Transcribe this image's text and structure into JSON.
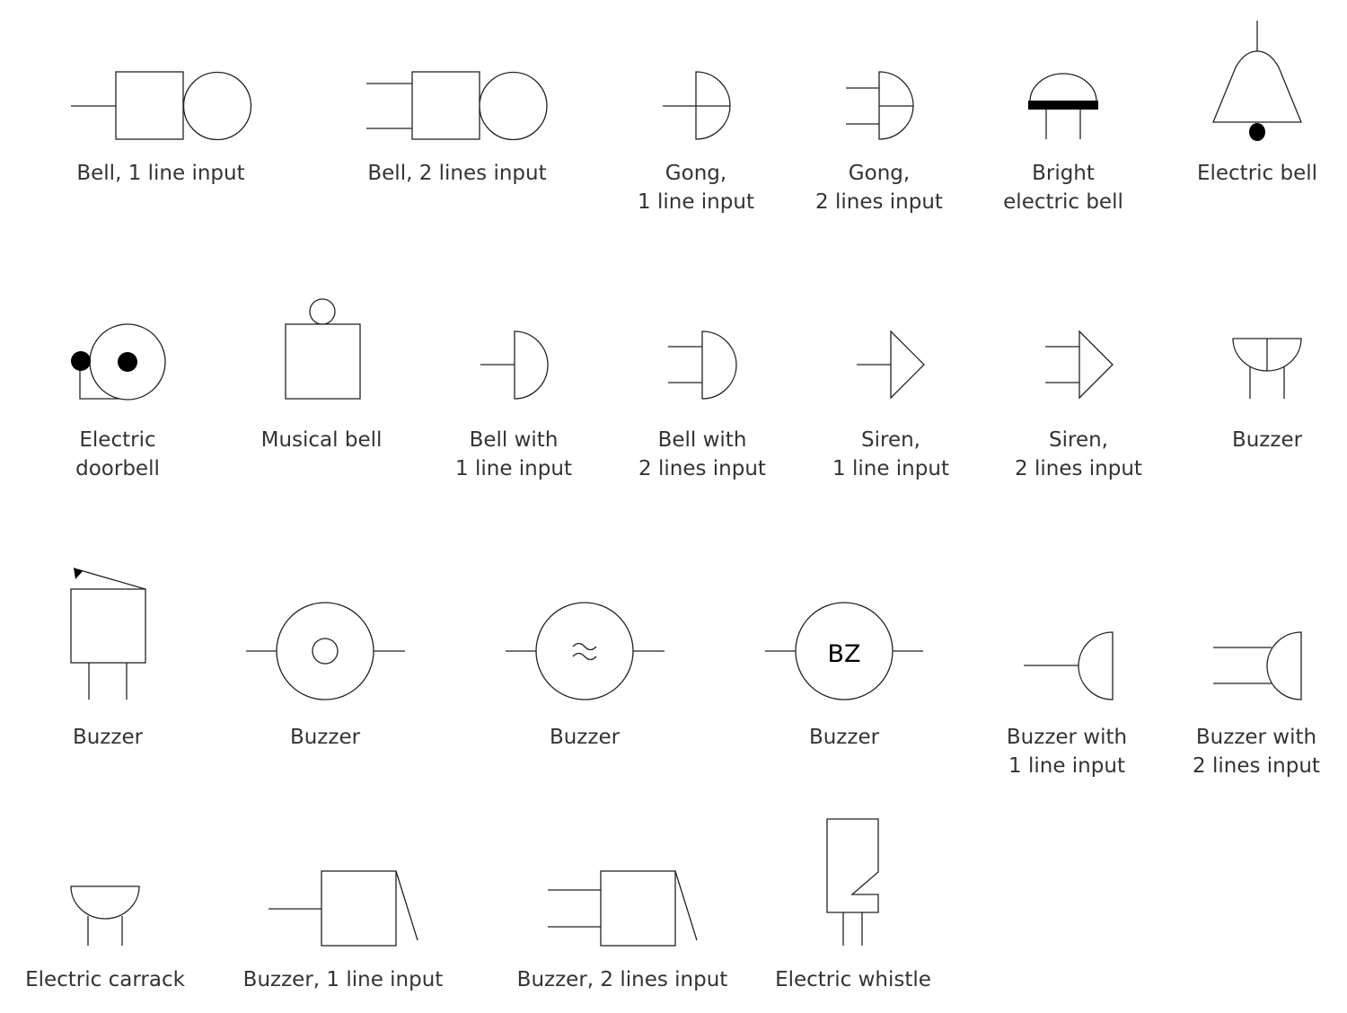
{
  "symbols": [
    {
      "id": "bell-1-line",
      "label": [
        "Bell, 1 line input"
      ]
    },
    {
      "id": "bell-2-lines",
      "label": [
        "Bell, 2 lines input"
      ]
    },
    {
      "id": "gong-1-line",
      "label": [
        "Gong,",
        "1 line input"
      ]
    },
    {
      "id": "gong-2-lines",
      "label": [
        "Gong,",
        "2 lines input"
      ]
    },
    {
      "id": "bright-electric-bell",
      "label": [
        "Bright",
        "electric bell"
      ]
    },
    {
      "id": "electric-bell",
      "label": [
        "Electric bell"
      ]
    },
    {
      "id": "electric-doorbell",
      "label": [
        "Electric",
        "doorbell"
      ]
    },
    {
      "id": "musical-bell",
      "label": [
        "Musical bell"
      ]
    },
    {
      "id": "bell-with-1-line",
      "label": [
        "Bell with",
        "1 line input"
      ]
    },
    {
      "id": "bell-with-2-lines",
      "label": [
        "Bell with",
        "2 lines input"
      ]
    },
    {
      "id": "siren-1-line",
      "label": [
        "Siren,",
        "1 line input"
      ]
    },
    {
      "id": "siren-2-lines",
      "label": [
        "Siren,",
        "2 lines input"
      ]
    },
    {
      "id": "buzzer-dome",
      "label": [
        "Buzzer"
      ]
    },
    {
      "id": "buzzer-box",
      "label": [
        "Buzzer"
      ]
    },
    {
      "id": "buzzer-circle",
      "label": [
        "Buzzer"
      ]
    },
    {
      "id": "buzzer-tilde",
      "label": [
        "Buzzer"
      ]
    },
    {
      "id": "buzzer-bz",
      "label": [
        "Buzzer"
      ],
      "inner_text": "BZ"
    },
    {
      "id": "buzzer-with-1-line",
      "label": [
        "Buzzer with",
        "1 line input"
      ]
    },
    {
      "id": "buzzer-with-2-lines",
      "label": [
        "Buzzer with",
        "2 lines input"
      ]
    },
    {
      "id": "electric-carrack",
      "label": [
        "Electric carrack"
      ]
    },
    {
      "id": "buzzer-1-line",
      "label": [
        "Buzzer, 1 line input"
      ]
    },
    {
      "id": "buzzer-2-lines",
      "label": [
        "Buzzer, 2 lines input"
      ]
    },
    {
      "id": "electric-whistle",
      "label": [
        "Electric whistle"
      ]
    }
  ],
  "colors": {
    "stroke": "#222222",
    "text": "#333333",
    "fill": "#000000"
  }
}
